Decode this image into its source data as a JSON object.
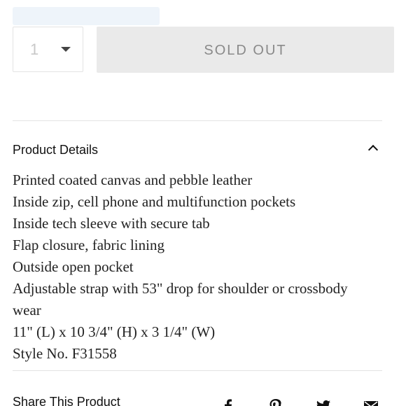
{
  "quantity": {
    "value": "1"
  },
  "sold_out_button": {
    "label": "SOLD OUT"
  },
  "product_details": {
    "title": "Product Details",
    "items": [
      "Printed coated canvas and pebble leather",
      "Inside zip, cell phone and multifunction pockets",
      "Inside tech sleeve with secure tab",
      "Flap closure, fabric lining",
      "Outside open pocket",
      "Adjustable strap with 53\" drop for shoulder or crossbody",
      "wear",
      "11\" (L) x 10 3/4\" (H) x 3 1/4\" (W)",
      "Style No. F31558"
    ]
  },
  "share": {
    "title": "Share This Product",
    "icons": [
      "facebook-icon",
      "pinterest-icon",
      "twitter-icon",
      "email-icon"
    ]
  },
  "colors": {
    "button_bg": "#eaeaea",
    "button_text": "#8a8a8a",
    "divider": "#e3e3e3",
    "text": "#222222"
  }
}
